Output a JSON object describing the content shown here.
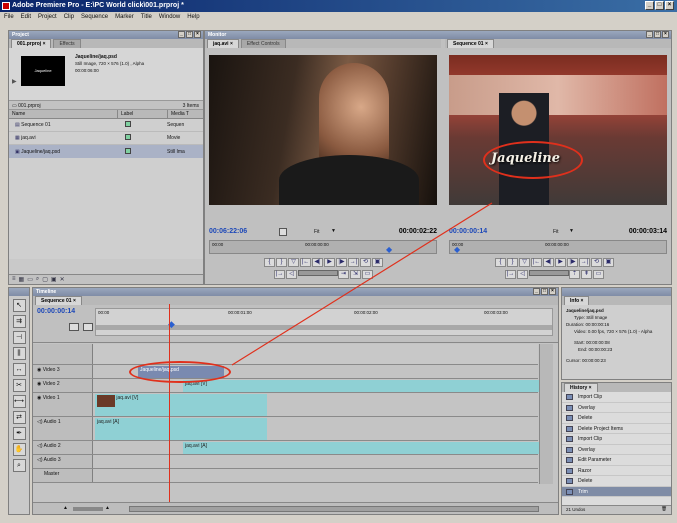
{
  "app": {
    "title": "Adobe Premiere Pro - E:\\PC World click\\001.prproj *"
  },
  "menu": [
    "File",
    "Edit",
    "Project",
    "Clip",
    "Sequence",
    "Marker",
    "Title",
    "Window",
    "Help"
  ],
  "project": {
    "panel_title": "Project",
    "tabs": [
      "001.prproj ×",
      "Effects"
    ],
    "preview": {
      "name": "Jaqueline/jaq.psd",
      "info1": "Still Image, 720 × 576 (1.0) , Alpha",
      "info2": "00:00:06:00",
      "thumb_label": "Jaqueline"
    },
    "project_file": "001.prproj",
    "item_count": "3 Items",
    "columns": [
      "Name",
      "Label",
      "Media T"
    ],
    "items": [
      {
        "name": "Sequence 01",
        "type": "Sequen"
      },
      {
        "name": "jaq.avi",
        "type": "Movie"
      },
      {
        "name": "Jaqueline/jaq.psd",
        "type": "Still Ima"
      }
    ]
  },
  "source_monitor": {
    "panel_title": "Monitor",
    "tabs": [
      "jaq.avi ×",
      "Effect Controls"
    ],
    "timecode_in": "00:06:22:06",
    "fit": "Fit",
    "timecode_dur": "00:00:02:22",
    "ruler_start": "00:00",
    "ruler_mid": "00:00:00:00"
  },
  "program_monitor": {
    "tabs": [
      "Sequence 01 ×"
    ],
    "timecode_in": "00:00:00:14",
    "fit": "Fit",
    "timecode_dur": "00:00:03:14",
    "ruler_start": "00:00",
    "ruler_mid": "00:00:00:00",
    "title_overlay": "Jaqueline"
  },
  "timeline": {
    "panel_title": "Timeline",
    "tab": "Sequence 01 ×",
    "timecode": "00:00:00:14",
    "ruler": [
      "00:00",
      "00:00:01:00",
      "00:00:02:00",
      "00:00:03:00"
    ],
    "tracks": [
      {
        "name": "Video 3"
      },
      {
        "name": "Video 2"
      },
      {
        "name": "Video 1"
      },
      {
        "name": "Audio 1"
      },
      {
        "name": "Audio 2"
      },
      {
        "name": "Audio 3"
      },
      {
        "name": "Master"
      }
    ],
    "clips": {
      "v3": "Jaqueline/jaq.psd",
      "v2": "jaq.avi [V]",
      "v1": "jaq.avi [V]",
      "a1": "jaq.avi [A]",
      "a2": "jaq.avi [A]"
    }
  },
  "info": {
    "tab": "Info ×",
    "name": "Jaqueline/jaq.psd",
    "type": "Type: Still Image",
    "duration": "Duration: 00:00:00:16",
    "video": "Video: 0.00 fps, 720 × 576 (1.0) - Alpha",
    "start": "Start: 00:00:00:08",
    "end": "End: 00:00:00:23",
    "cursor": "Cursor: 00:00:00:23"
  },
  "history": {
    "tab": "History ×",
    "items": [
      "Import Clip",
      "Overlay",
      "Delete",
      "Delete Project Items",
      "Import Clip",
      "Overlay",
      "Edit Parameter",
      "Razor",
      "Delete",
      "Trim"
    ],
    "undo_count": "21 Undos"
  },
  "colors": {
    "accent_blue": "#1d48b8",
    "callout_red": "#e0301c",
    "clip_teal": "#8fd0d4"
  }
}
